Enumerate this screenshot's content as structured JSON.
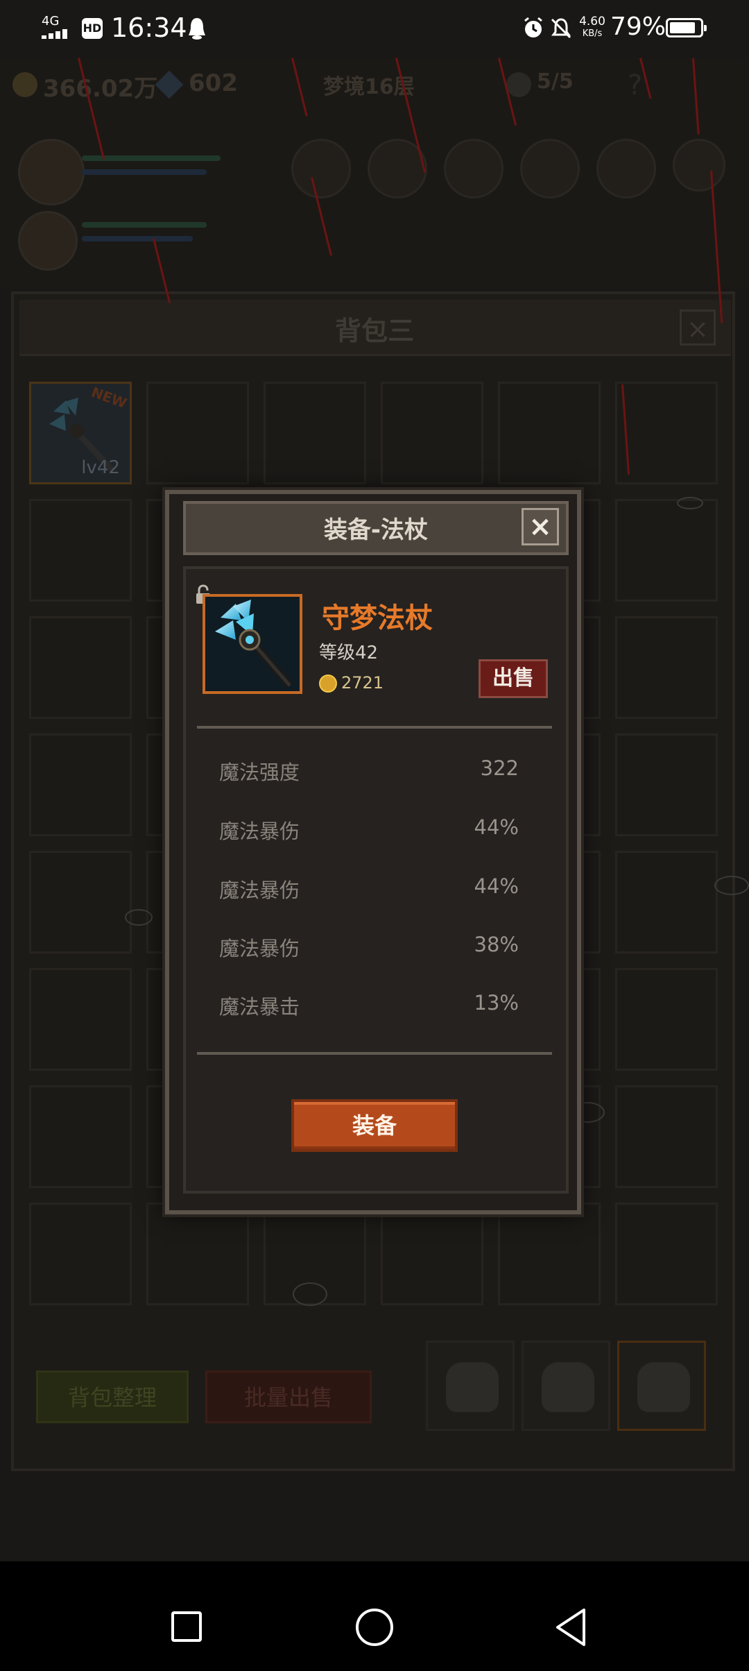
{
  "status_bar": {
    "network": "4G",
    "hd": "HD",
    "time": "16:34",
    "speed_value": "4.60",
    "speed_unit": "KB/s",
    "battery": "79%"
  },
  "game": {
    "gold": "366.02万",
    "gems": "602",
    "dream_level": "梦境16层",
    "skull_count": "5/5",
    "help": "?"
  },
  "bag": {
    "title": "背包三",
    "close": "×",
    "first_slot_level": "lv42",
    "first_slot_badge": "NEW",
    "sort_button": "背包整理",
    "bulk_sell_button": "批量出售",
    "active_tab": 3
  },
  "dialog": {
    "title": "装备-法杖",
    "close": "×",
    "item": {
      "name": "守梦法杖",
      "level_text": "等级42",
      "price": "2721",
      "sell_label": "出售"
    },
    "stats": [
      {
        "name": "魔法强度",
        "value": "322"
      },
      {
        "name": "魔法暴伤",
        "value": "44%"
      },
      {
        "name": "魔法暴伤",
        "value": "44%"
      },
      {
        "name": "魔法暴伤",
        "value": "38%"
      },
      {
        "name": "魔法暴击",
        "value": "13%"
      }
    ],
    "equip_label": "装备"
  },
  "colors": {
    "item_name": "#e77a2a",
    "equip_button": "#b44a1c",
    "sell_button": "#6a1c18",
    "rain": "#6b1412"
  }
}
